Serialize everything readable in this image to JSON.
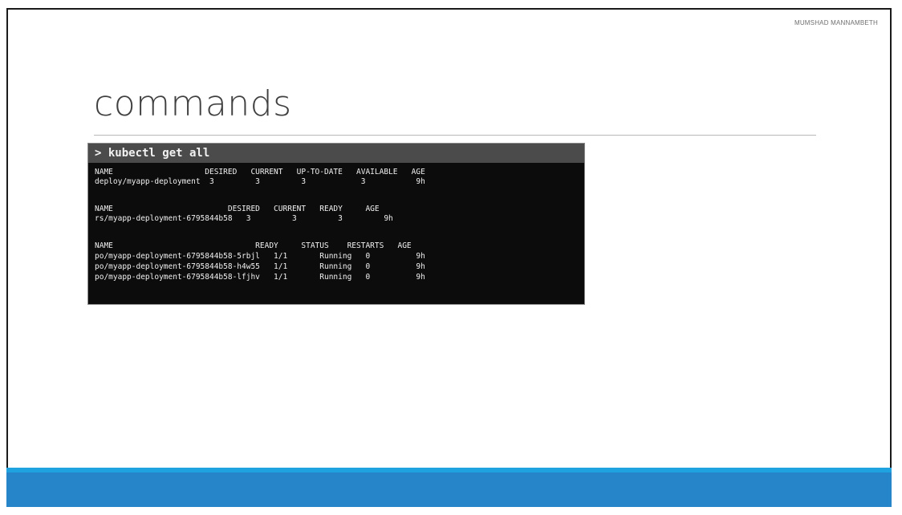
{
  "slide": {
    "author": "MUMSHAD MANNAMBETH",
    "title": "commands"
  },
  "terminal": {
    "command": "> kubectl get all",
    "lines": [
      "NAME                    DESIRED   CURRENT   UP-TO-DATE   AVAILABLE   AGE",
      "deploy/myapp-deployment  3         3         3            3           9h",
      "",
      "NAME                         DESIRED   CURRENT   READY     AGE",
      "rs/myapp-deployment-6795844b58   3         3         3         9h",
      "",
      "NAME                               READY     STATUS    RESTARTS   AGE",
      "po/myapp-deployment-6795844b58-5rbjl   1/1       Running   0          9h",
      "po/myapp-deployment-6795844b58-h4w55   1/1       Running   0          9h",
      "po/myapp-deployment-6795844b58-lfjhv   1/1       Running   0          9h"
    ]
  },
  "colors": {
    "accent_bar_light": "#1fa3e0",
    "accent_bar_dark": "#2684c8",
    "terminal_bg": "#0c0c0c",
    "terminal_header": "#4b4b4b"
  }
}
